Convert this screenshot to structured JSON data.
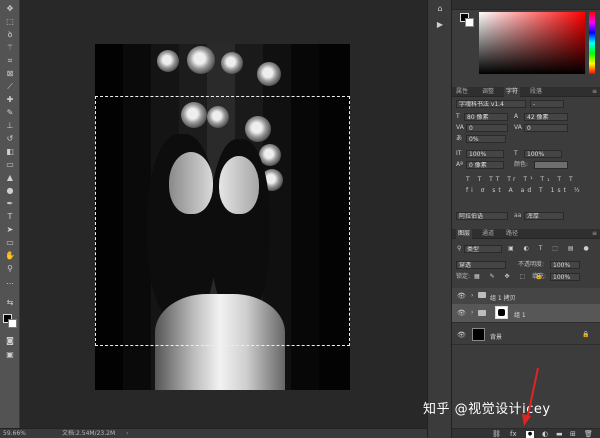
{
  "status": {
    "zoom": "59.66%",
    "doc_info": "文档:2.54M/23.2M"
  },
  "character_panel": {
    "tabs": [
      "属性",
      "调整",
      "字符",
      "段落"
    ],
    "font_family": "字魂科书法 v1.4",
    "font_style": "-",
    "font_size": "80 像素",
    "leading": "42 像素",
    "kerning": "0",
    "tracking": "0",
    "vertical_scale_percent": "0%",
    "scale_h": "100%",
    "scale_v": "100%",
    "baseline_shift": "0 像素",
    "color_label": "颜色:",
    "language": "阿拉伯语",
    "antialias": "浑厚",
    "aa_label": "aa"
  },
  "layers_panel": {
    "tabs": [
      "图层",
      "通道",
      "路径"
    ],
    "filter_kind": "类型",
    "blend_mode": "穿透",
    "opacity_label": "不透明度:",
    "opacity_value": "100%",
    "lock_label": "锁定:",
    "fill_label": "填充:",
    "fill_value": "100%",
    "layers": [
      {
        "name": "组 1 拷贝"
      },
      {
        "name": "组 1"
      },
      {
        "name": "背景"
      }
    ]
  },
  "watermark": "知乎 @视觉设计icey",
  "colors": {
    "arrow": "#e02424",
    "accent_bg": "#3c3c3c"
  }
}
